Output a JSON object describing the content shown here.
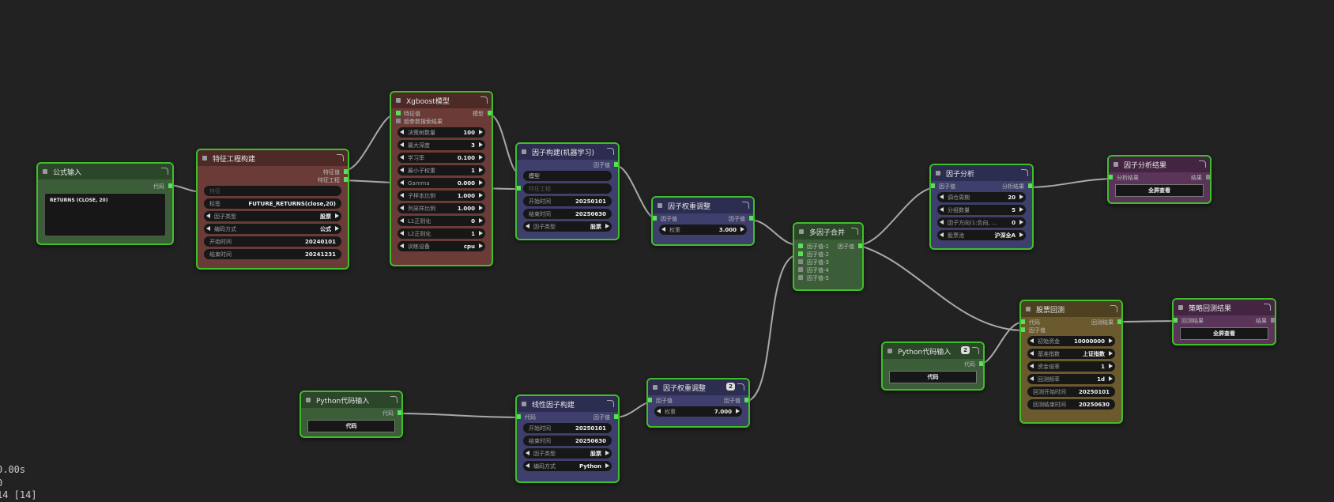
{
  "nodes": {
    "formula": {
      "title": "公式输入",
      "out1": "代码",
      "code": "RETURNS (CLOSE, 20)"
    },
    "feature": {
      "title": "特征工程构建",
      "out1": "特征值",
      "out2": "特征工程",
      "in1": "特征",
      "w": [
        {
          "l": "标签",
          "v": "FUTURE_RETURNS(close,20)"
        },
        {
          "l": "因子类型",
          "v": "股票"
        },
        {
          "l": "编码方式",
          "v": "公式"
        },
        {
          "l": "开始时间",
          "v": "20240101"
        },
        {
          "l": "结束时间",
          "v": "20241231"
        }
      ]
    },
    "xgb": {
      "title": "Xgboost模型",
      "in1": "特征值",
      "out1": "模型",
      "in2": "超参数搜索结果",
      "w": [
        {
          "l": "决策树数量",
          "v": "100"
        },
        {
          "l": "最大深度",
          "v": "3"
        },
        {
          "l": "学习率",
          "v": "0.100"
        },
        {
          "l": "最小子权重",
          "v": "1"
        },
        {
          "l": "Gamma",
          "v": "0.000"
        },
        {
          "l": "子样本比例",
          "v": "1.000"
        },
        {
          "l": "列采样比例",
          "v": "1.000"
        },
        {
          "l": "L1正则化",
          "v": "0"
        },
        {
          "l": "L2正则化",
          "v": "1"
        },
        {
          "l": "训练设备",
          "v": "cpu"
        }
      ]
    },
    "ml": {
      "title": "因子构建(机器学习)",
      "out1": "因子值",
      "in1": "模型",
      "in2": "特征工程",
      "w": [
        {
          "l": "开始时间",
          "v": "20250101"
        },
        {
          "l": "结束时间",
          "v": "20250630"
        },
        {
          "l": "因子类型",
          "v": "股票"
        }
      ]
    },
    "weight1": {
      "title": "因子权重调整",
      "in1": "因子值",
      "out1": "因子值",
      "w": [
        {
          "l": "权重",
          "v": "3.000"
        }
      ]
    },
    "merge": {
      "title": "多因子合并",
      "in": [
        "因子值-1",
        "因子值-2",
        "因子值-3",
        "因子值-4",
        "因子值-5"
      ],
      "out1": "因子值"
    },
    "analysis": {
      "title": "因子分析",
      "in1": "因子值",
      "out1": "分析结果",
      "w": [
        {
          "l": "调仓周期",
          "v": "20"
        },
        {
          "l": "分组数量",
          "v": "5"
        },
        {
          "l": "因子方向(1:负向, ...",
          "v": "0"
        },
        {
          "l": "股票池",
          "v": "沪深全A"
        }
      ]
    },
    "analysisResult": {
      "title": "因子分析结果",
      "in1": "分析结果",
      "out1": "结果",
      "button": "全屏查看"
    },
    "python1": {
      "title": "Python代码输入",
      "out1": "代码",
      "button": "代码"
    },
    "linear": {
      "title": "线性因子构建",
      "in1": "代码",
      "out1": "因子值",
      "w": [
        {
          "l": "开始时间",
          "v": "20250101"
        },
        {
          "l": "结束时间",
          "v": "20250630"
        },
        {
          "l": "因子类型",
          "v": "股票"
        },
        {
          "l": "编码方式",
          "v": "Python"
        }
      ]
    },
    "weight2": {
      "title": "因子权重调整",
      "badge": "2",
      "in1": "因子值",
      "out1": "因子值",
      "w": [
        {
          "l": "权重",
          "v": "7.000"
        }
      ]
    },
    "python2": {
      "title": "Python代码输入",
      "badge": "2",
      "out1": "代码",
      "button": "代码"
    },
    "backtest": {
      "title": "股票回测",
      "in1": "代码",
      "in2": "因子值",
      "out1": "回测结果",
      "w": [
        {
          "l": "初始资金",
          "v": "10000000"
        },
        {
          "l": "基准指数",
          "v": "上证指数"
        },
        {
          "l": "资金倍率",
          "v": "1"
        },
        {
          "l": "回测频率",
          "v": "1d"
        },
        {
          "l": "回测开始时间",
          "v": "20250101"
        },
        {
          "l": "回测结束时间",
          "v": "20250630"
        }
      ]
    },
    "backtestResult": {
      "title": "策略回测结果",
      "in1": "回测结果",
      "out1": "结果",
      "button": "全屏查看"
    }
  },
  "stats": {
    "line1": "0.00s",
    "line2": "0",
    "line3": "14 [14]"
  },
  "colors": {
    "border": "#3fbf2a",
    "link": "#a9a9a9",
    "slot": "#58e058",
    "canvas": "#222222"
  }
}
